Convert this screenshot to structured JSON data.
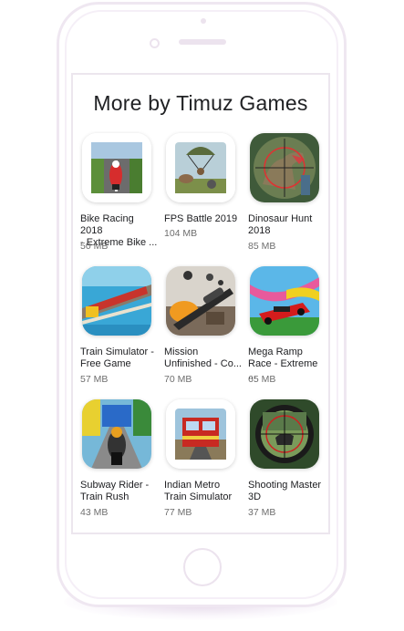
{
  "page": {
    "title": "More by Timuz Games"
  },
  "apps": [
    {
      "name": "Bike Racing 2018\n- Extreme Bike ...",
      "size": "50 MB",
      "icon": "bike-racing-icon"
    },
    {
      "name": "FPS Battle 2019",
      "size": "104 MB",
      "icon": "fps-battle-icon"
    },
    {
      "name": "Dinosaur Hunt\n2018",
      "size": "85 MB",
      "icon": "dinosaur-hunt-icon"
    },
    {
      "name": "Train Simulator -\nFree Game",
      "size": "57 MB",
      "icon": "train-simulator-icon"
    },
    {
      "name": "Mission\nUnfinished - Co...",
      "size": "70 MB",
      "icon": "mission-unfinished-icon"
    },
    {
      "name": "Mega Ramp\nRace - Extreme ...",
      "size": "65 MB",
      "icon": "mega-ramp-icon"
    },
    {
      "name": "Subway Rider -\nTrain Rush",
      "size": "43 MB",
      "icon": "subway-rider-icon"
    },
    {
      "name": "Indian Metro\nTrain Simulator",
      "size": "77 MB",
      "icon": "indian-metro-icon"
    },
    {
      "name": "Shooting Master\n3D",
      "size": "37 MB",
      "icon": "shooting-master-icon"
    }
  ]
}
